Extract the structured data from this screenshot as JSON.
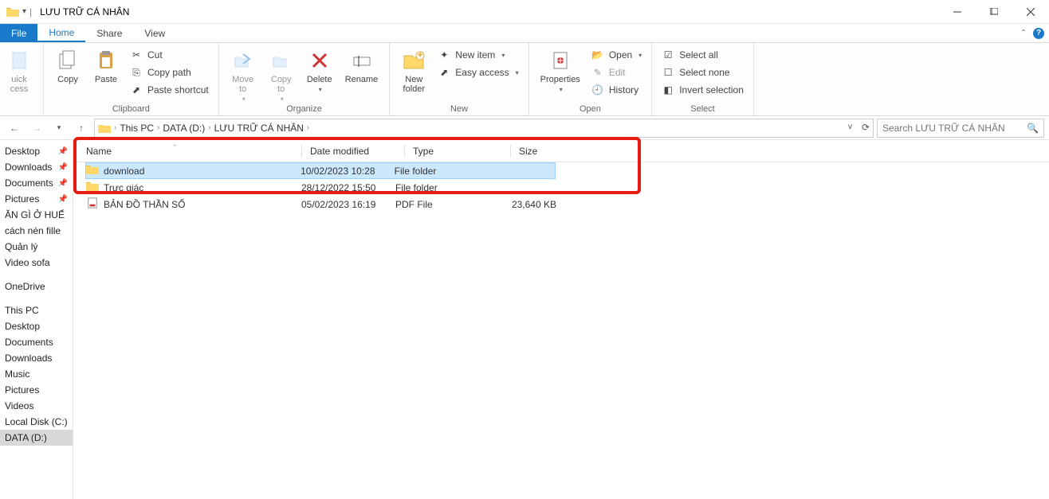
{
  "window": {
    "title": "LƯU TRỮ CÁ NHÂN"
  },
  "tabs": {
    "file": "File",
    "home": "Home",
    "share": "Share",
    "view": "View"
  },
  "ribbon": {
    "quick_access": "uick\ncess",
    "clipboard": {
      "label": "Clipboard",
      "copy": "Copy",
      "paste": "Paste",
      "cut": "Cut",
      "copy_path": "Copy path",
      "paste_shortcut": "Paste shortcut"
    },
    "organize": {
      "label": "Organize",
      "move_to": "Move\nto",
      "copy_to": "Copy\nto",
      "delete": "Delete",
      "rename": "Rename"
    },
    "new": {
      "label": "New",
      "new_folder": "New\nfolder",
      "new_item": "New item",
      "easy_access": "Easy access"
    },
    "open": {
      "label": "Open",
      "properties": "Properties",
      "open": "Open",
      "edit": "Edit",
      "history": "History"
    },
    "select": {
      "label": "Select",
      "select_all": "Select all",
      "select_none": "Select none",
      "invert": "Invert selection"
    }
  },
  "breadcrumb": {
    "items": [
      "This PC",
      "DATA (D:)",
      "LƯU TRỮ CÁ NHÂN"
    ]
  },
  "search": {
    "placeholder": "Search LƯU TRỮ CÁ NHÂN"
  },
  "nav": {
    "items": [
      {
        "label": "Desktop",
        "pin": true
      },
      {
        "label": "Downloads",
        "pin": true
      },
      {
        "label": "Documents",
        "pin": true
      },
      {
        "label": "Pictures",
        "pin": true
      },
      {
        "label": "ĂN GÌ Ở HUẾ",
        "pin": false
      },
      {
        "label": "cách nén fille",
        "pin": false
      },
      {
        "label": "Quản lý",
        "pin": false
      },
      {
        "label": "Video sofa",
        "pin": false
      }
    ],
    "onedrive": "OneDrive",
    "thispc": "This PC",
    "thispc_children": [
      "Desktop",
      "Documents",
      "Downloads",
      "Music",
      "Pictures",
      "Videos",
      "Local Disk (C:)",
      "DATA (D:)"
    ]
  },
  "columns": {
    "name": "Name",
    "date": "Date modified",
    "type": "Type",
    "size": "Size"
  },
  "files": [
    {
      "icon": "folder",
      "name": "download",
      "date": "10/02/2023 10:28",
      "type": "File folder",
      "size": "",
      "selected": true
    },
    {
      "icon": "folder",
      "name": "Trực giác",
      "date": "28/12/2022 15:50",
      "type": "File folder",
      "size": ""
    },
    {
      "icon": "pdf",
      "name": "BẢN ĐỒ THẦN SỐ",
      "date": "05/02/2023 16:19",
      "type": "PDF File",
      "size": "23,640 KB"
    }
  ]
}
